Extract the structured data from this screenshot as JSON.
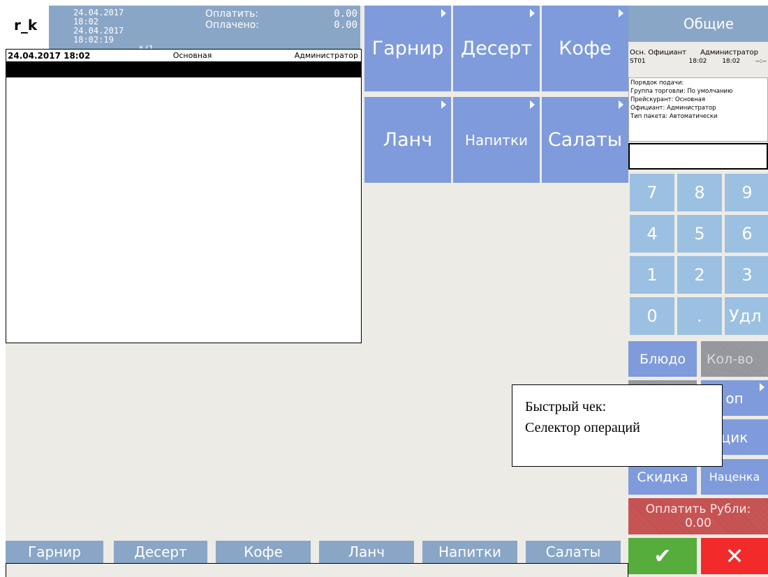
{
  "header": {
    "station": "r_k",
    "date_open": "24.04.2017 18:02",
    "date_current": "24.04.2017 18:02:19",
    "guest": "*/1",
    "to_pay_label": "Оплатить:",
    "to_pay_value": "0.00",
    "paid_label": "Оплачено:",
    "paid_value": "0.00"
  },
  "order": {
    "datetime": "24.04.2017 18:02",
    "price_list": "Основная",
    "waiter": "Администратор"
  },
  "categories": [
    "Гарнир",
    "Десерт",
    "Кофе",
    "Ланч",
    "Напитки",
    "Салаты"
  ],
  "right": {
    "group_button": "Общие",
    "waiter_label": "Осн. Официант",
    "waiter_name": "Администратор",
    "table": "ST01",
    "time1": "18:02",
    "time2": "18:02",
    "time3": "--:--",
    "info_lines": [
      "Порядок подачи:",
      "Группа торговли: По умолчанию",
      "Прейскурант: Основная",
      "Официант: Администратор",
      "Тип пакета: Автоматически"
    ]
  },
  "keypad": [
    "7",
    "8",
    "9",
    "4",
    "5",
    "6",
    "1",
    "2",
    "3",
    "0",
    ".",
    "Удл"
  ],
  "functions": {
    "dish": "Блюдо",
    "quantity": "Кол-во",
    "extra_partial": "оп",
    "register_partial": "цик",
    "discount": "Скидка",
    "markup": "Наценка",
    "pay_label": "Оплатить Рубли:",
    "pay_value": "0.00",
    "ok_icon": "✔",
    "cancel_icon": "✕"
  },
  "callout": {
    "line1": "Быстрый чек:",
    "line2": "Селектор операций"
  }
}
